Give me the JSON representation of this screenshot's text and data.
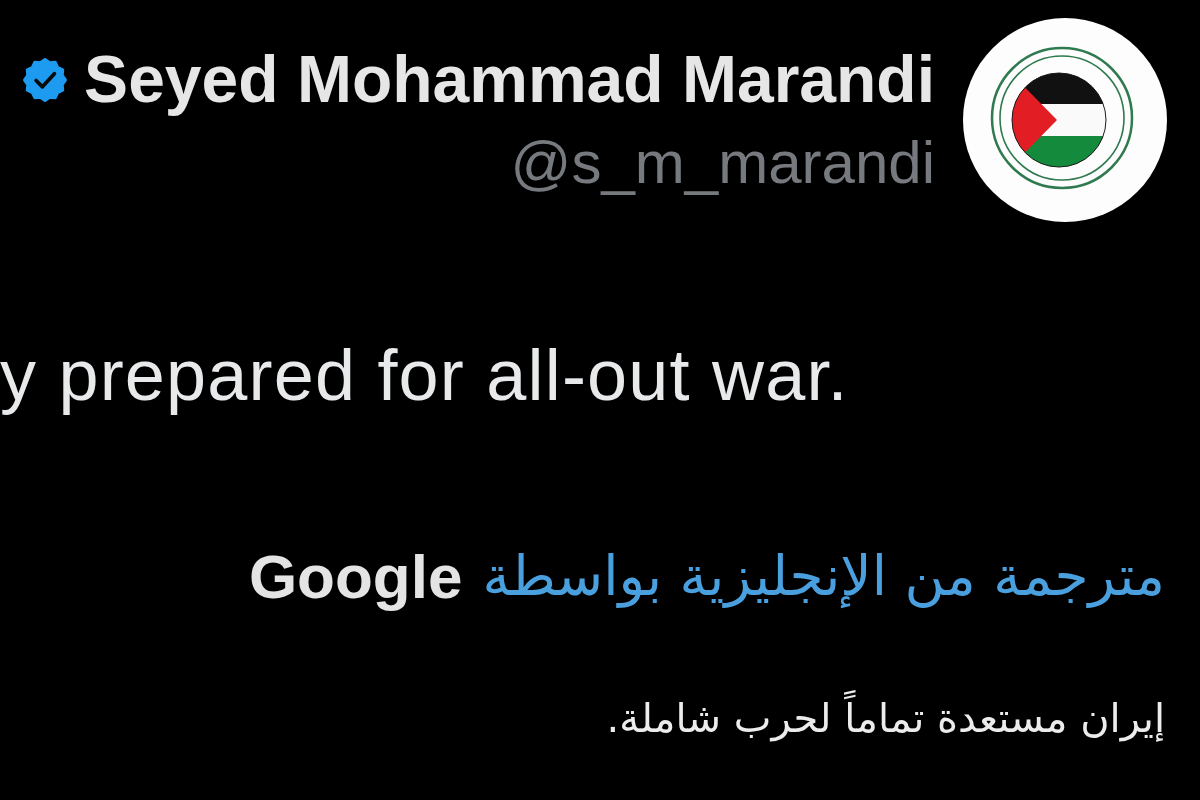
{
  "author": {
    "name": "Seyed Mohammad Marandi",
    "verified": true,
    "handle": "@s_m_marandi"
  },
  "tweet": {
    "text": "y prepared for all-out war."
  },
  "translation": {
    "label": "مترجمة من الإنجليزية بواسطة",
    "provider": "Google",
    "text": "إيران مستعدة تماماً لحرب شاملة."
  }
}
